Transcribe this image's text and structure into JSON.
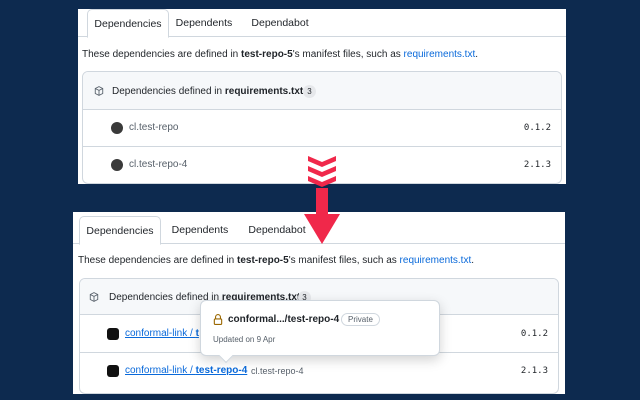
{
  "colors": {
    "background": "#0d2a4f",
    "arrow": "#f0284a",
    "link": "#0969da"
  },
  "before": {
    "tabs": [
      {
        "label": "Dependencies",
        "active": true
      },
      {
        "label": "Dependents"
      },
      {
        "label": "Dependabot"
      }
    ],
    "description": {
      "prefix": "These dependencies are defined in ",
      "repo": "test-repo-5",
      "middle": "'s manifest files, such as ",
      "file": "requirements.txt",
      "suffix": "."
    },
    "box": {
      "head_prefix": "Dependencies defined in ",
      "head_file": "requirements.txt",
      "count": "3",
      "rows": [
        {
          "name": "cl.test-repo",
          "version": "0.1.2"
        },
        {
          "name": "cl.test-repo-4",
          "version": "2.1.3"
        }
      ]
    }
  },
  "after": {
    "tabs": [
      {
        "label": "Dependencies",
        "active": true
      },
      {
        "label": "Dependents"
      },
      {
        "label": "Dependabot"
      }
    ],
    "description": {
      "prefix": "These dependencies are defined in ",
      "repo": "test-repo-5",
      "middle": "'s manifest files, such as ",
      "file": "requirements.txt",
      "suffix": "."
    },
    "box": {
      "head_prefix": "Dependencies defined in ",
      "head_file": "requirements.txt",
      "count": "3",
      "rows": [
        {
          "link_owner": "conformal-link / ",
          "link_repo": "t",
          "version": "0.1.2"
        },
        {
          "link_owner": "conformal-link / ",
          "link_repo": "test-repo-4",
          "sub": "cl.test-repo-4",
          "version": "2.1.3"
        }
      ]
    },
    "popover": {
      "title": "conformal.../test-repo-4",
      "badge": "Private",
      "updated": "Updated on 9 Apr"
    }
  }
}
